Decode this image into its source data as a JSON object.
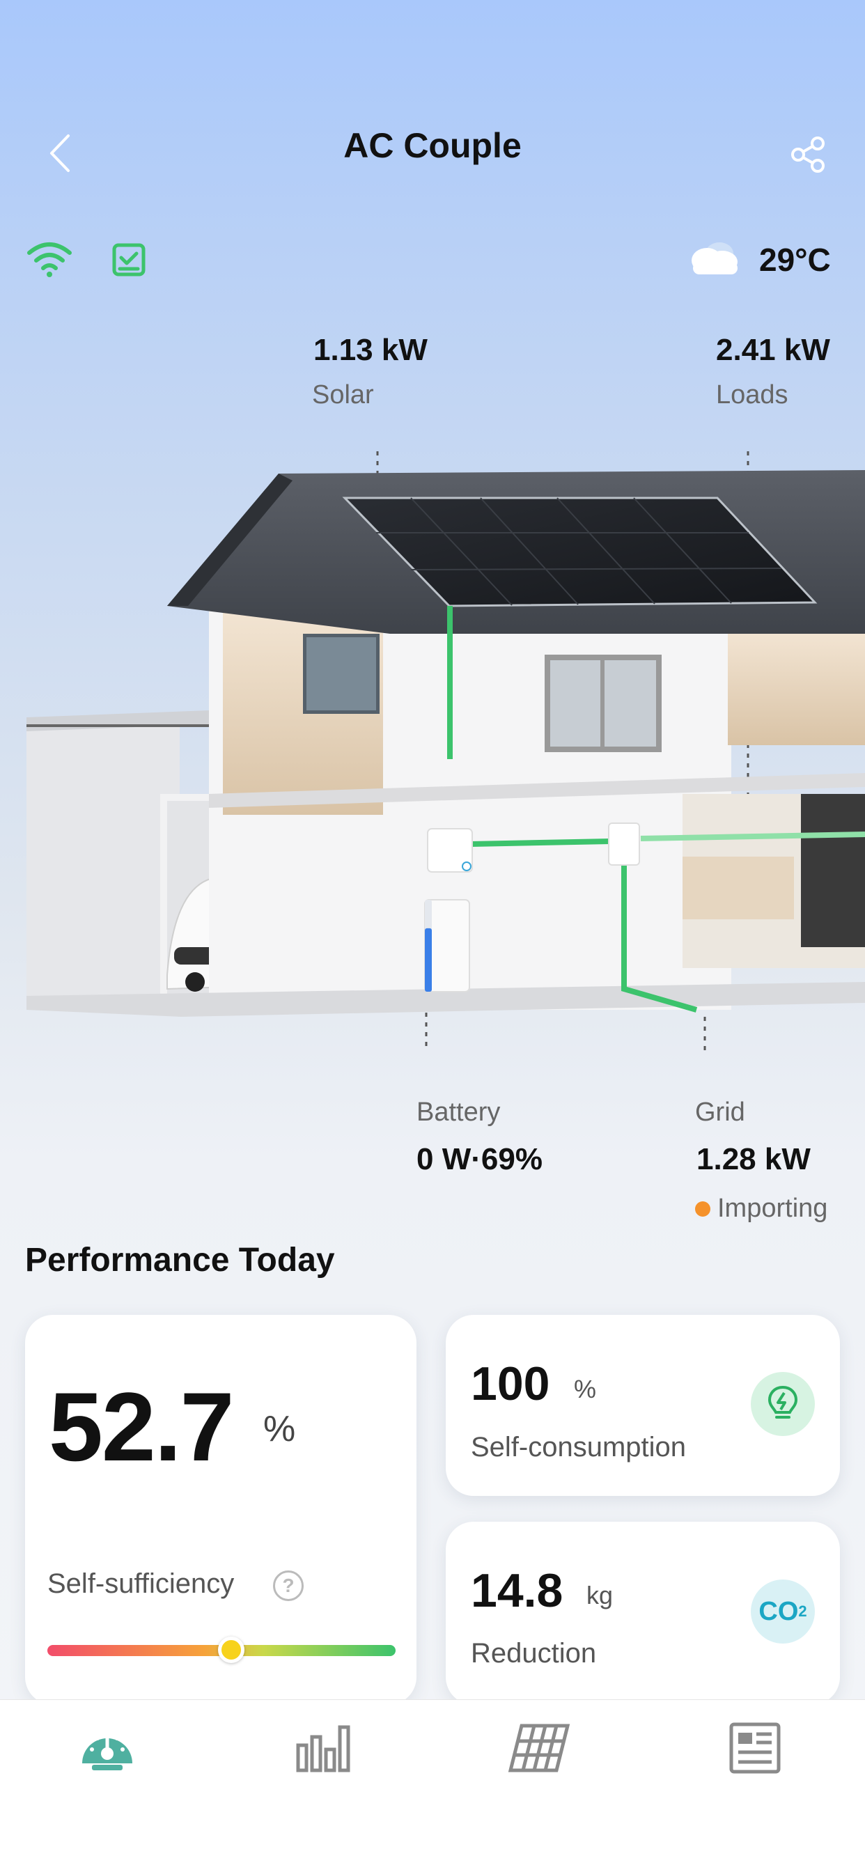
{
  "header": {
    "title": "AC Couple"
  },
  "status": {
    "weather_icon": "cloud-icon",
    "temperature": "29°C"
  },
  "flows": {
    "solar": {
      "value": "1.13 kW",
      "label": "Solar"
    },
    "loads": {
      "value": "2.41 kW",
      "label": "Loads"
    },
    "battery": {
      "label": "Battery",
      "value": "0 W·69%",
      "soc": 0.69
    },
    "grid": {
      "label": "Grid",
      "value": "1.28 kW",
      "status": "Importing",
      "status_color": "#f5922b"
    }
  },
  "performance": {
    "title": "Performance Today",
    "self_sufficiency": {
      "value": "52.7",
      "unit": "%",
      "label": "Self-sufficiency",
      "level": 0.527
    },
    "self_consumption": {
      "value": "100",
      "unit": "%",
      "label": "Self-consumption"
    },
    "reduction": {
      "value": "14.8",
      "unit": "kg",
      "label": "Reduction",
      "icon_text": "CO",
      "icon_sub": "2"
    }
  },
  "tabs": [
    {
      "name": "dashboard",
      "icon": "gauge-icon",
      "active": true
    },
    {
      "name": "statistics",
      "icon": "bar-chart-icon",
      "active": false
    },
    {
      "name": "devices",
      "icon": "solar-panel-icon",
      "active": false
    },
    {
      "name": "news",
      "icon": "document-icon",
      "active": false
    }
  ],
  "colors": {
    "accent_green": "#3cc36c",
    "battery_blue": "#3a7fe8",
    "tab_active": "#4fb0a0",
    "tab_inactive": "#8a8a8a"
  }
}
